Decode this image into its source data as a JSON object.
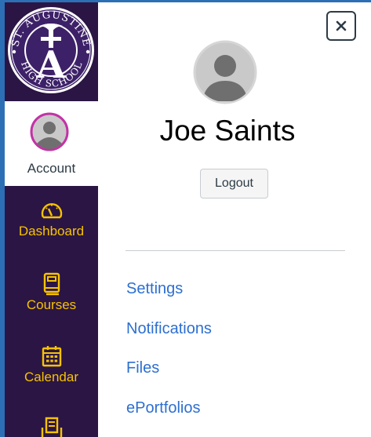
{
  "school_logo": {
    "top_text": "ST. AUGUSTINE",
    "bottom_text": "HIGH SCHOOL",
    "monogram": "A"
  },
  "global_nav": {
    "account": {
      "label": "Account"
    },
    "items": [
      {
        "label": "Dashboard",
        "icon": "dashboard-icon"
      },
      {
        "label": "Courses",
        "icon": "courses-icon"
      },
      {
        "label": "Calendar",
        "icon": "calendar-icon"
      },
      {
        "label": "",
        "icon": "inbox-icon"
      }
    ]
  },
  "tray": {
    "close_label": "×",
    "user_name": "Joe Saints",
    "logout_label": "Logout",
    "links": [
      {
        "label": "Settings"
      },
      {
        "label": "Notifications"
      },
      {
        "label": "Files"
      },
      {
        "label": "ePortfolios"
      }
    ]
  },
  "colors": {
    "nav_background": "#2b1544",
    "nav_accent": "#f7c300",
    "link": "#2d6fd0",
    "avatar_ring": "#c233a6",
    "frame_border": "#2d6fb5"
  }
}
